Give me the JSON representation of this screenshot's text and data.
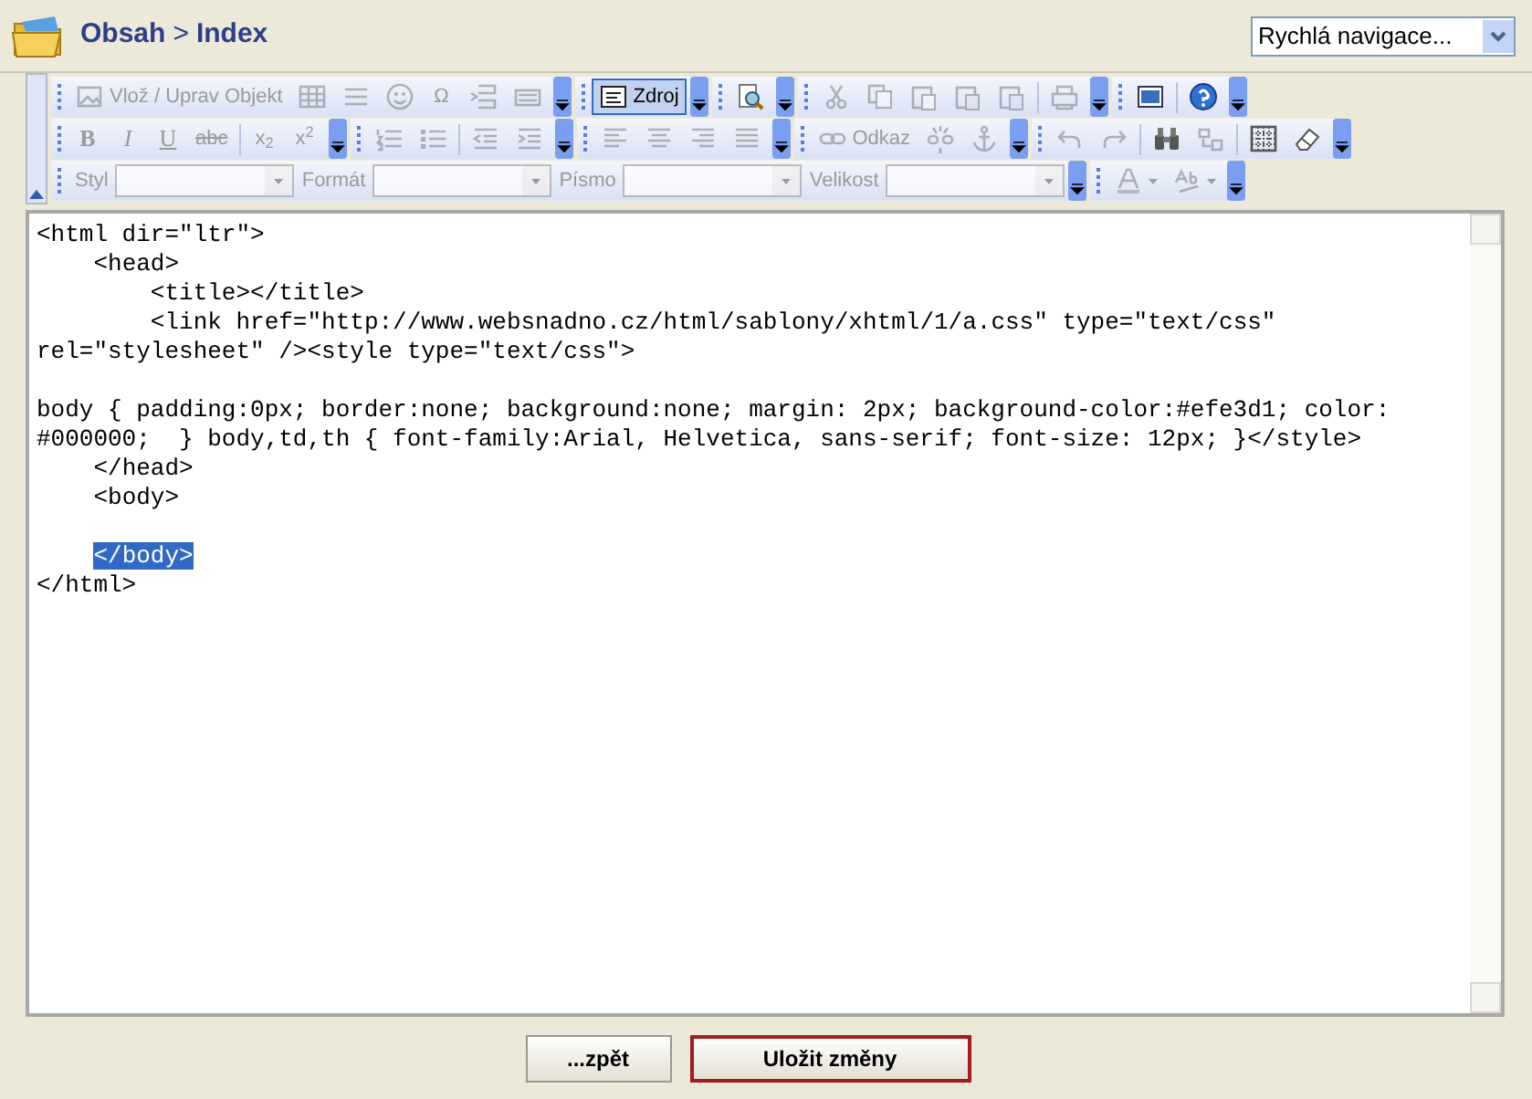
{
  "header": {
    "breadcrumb": [
      {
        "label": "Obsah"
      },
      {
        "label": "Index"
      }
    ],
    "separator": ">"
  },
  "quick_nav": {
    "value": "Rychlá navigace..."
  },
  "toolbar": {
    "rows": [
      {
        "groups": [
          {
            "items": [
              {
                "kind": "button",
                "label": "Vlož / Uprav Objekt",
                "disabled": true
              },
              {
                "kind": "button",
                "disabled": true
              },
              {
                "kind": "button",
                "disabled": true
              },
              {
                "kind": "button",
                "disabled": true
              },
              {
                "kind": "button",
                "label": "Ω",
                "disabled": true
              },
              {
                "kind": "button",
                "disabled": true
              },
              {
                "kind": "button",
                "disabled": true
              }
            ]
          },
          {
            "items": [
              {
                "kind": "button",
                "label": "Zdroj",
                "disabled": false,
                "selected": true
              }
            ]
          },
          {
            "items": [
              {
                "kind": "button",
                "disabled": false
              }
            ]
          },
          {
            "items": [
              {
                "kind": "button",
                "disabled": true
              },
              {
                "kind": "button",
                "disabled": true
              },
              {
                "kind": "button",
                "disabled": true
              },
              {
                "kind": "button",
                "disabled": true
              },
              {
                "kind": "button",
                "disabled": true
              },
              {
                "kind": "separator"
              },
              {
                "kind": "button",
                "disabled": true
              }
            ]
          },
          {
            "items": [
              {
                "kind": "button",
                "disabled": false
              },
              {
                "kind": "separator"
              },
              {
                "kind": "button",
                "disabled": false
              }
            ]
          }
        ]
      },
      {
        "groups": [
          {
            "items": [
              {
                "kind": "button",
                "label": "B",
                "disabled": true
              },
              {
                "kind": "button",
                "label": "I",
                "disabled": true
              },
              {
                "kind": "button",
                "label": "U",
                "disabled": true
              },
              {
                "kind": "button",
                "label": "abc",
                "disabled": true
              },
              {
                "kind": "separator"
              },
              {
                "kind": "button",
                "label": "x$_{2}$",
                "disabled": true
              },
              {
                "kind": "button",
                "label": "x$^{2}$",
                "disabled": true
              }
            ]
          },
          {
            "items": [
              {
                "kind": "button",
                "disabled": true
              },
              {
                "kind": "button",
                "disabled": true
              },
              {
                "kind": "separator"
              },
              {
                "kind": "button",
                "disabled": true
              },
              {
                "kind": "button",
                "disabled": true
              }
            ]
          },
          {
            "items": [
              {
                "kind": "button",
                "disabled": true
              },
              {
                "kind": "button",
                "disabled": true
              },
              {
                "kind": "button",
                "disabled": true
              },
              {
                "kind": "button",
                "disabled": true
              }
            ]
          },
          {
            "items": [
              {
                "kind": "button",
                "label": "Odkaz",
                "disabled": true
              },
              {
                "kind": "button",
                "disabled": true
              },
              {
                "kind": "button",
                "disabled": true
              }
            ]
          },
          {
            "items": [
              {
                "kind": "button",
                "disabled": true
              },
              {
                "kind": "button",
                "disabled": true
              },
              {
                "kind": "separator"
              },
              {
                "kind": "button",
                "disabled": false
              },
              {
                "kind": "button",
                "disabled": true
              },
              {
                "kind": "separator"
              },
              {
                "kind": "button",
                "disabled": false
              },
              {
                "kind": "button",
                "disabled": false
              }
            ]
          }
        ]
      },
      {
        "groups": [
          {
            "items": [
              {
                "kind": "combo",
                "label": "Styl",
                "disabled": true
              },
              {
                "kind": "combo",
                "label": "Formát",
                "disabled": true
              },
              {
                "kind": "combo",
                "label": "Písmo",
                "disabled": true
              },
              {
                "kind": "combo",
                "label": "Velikost",
                "disabled": true
              }
            ]
          },
          {
            "items": [
              {
                "kind": "button",
                "disabled": true
              },
              {
                "kind": "button",
                "disabled": true
              }
            ]
          }
        ]
      }
    ]
  },
  "editor": {
    "segments": [
      {
        "text": "<html dir=\"ltr\">\n    <head>\n        <title></title>\n        <link href=\"http://www.websnadno.cz/html/sablony/xhtml/1/a.css\" type=\"text/css\" rel=\"stylesheet\" /><style type=\"text/css\">\n\nbody { padding:0px; border:none; background:none; margin: 2px; background-color:#efe3d1; color: #000000;  } body,td,th { font-family:Arial, Helvetica, sans-serif; font-size: 12px; }</style>\n    </head>\n    <body>\n\n    ",
        "selected": false
      },
      {
        "text": "</body>",
        "selected": true
      },
      {
        "text": "\n</html>",
        "selected": false
      }
    ]
  },
  "buttons": [
    {
      "label": "...zpět",
      "kind": "default"
    },
    {
      "label": "Uložit změny",
      "kind": "primary"
    }
  ]
}
